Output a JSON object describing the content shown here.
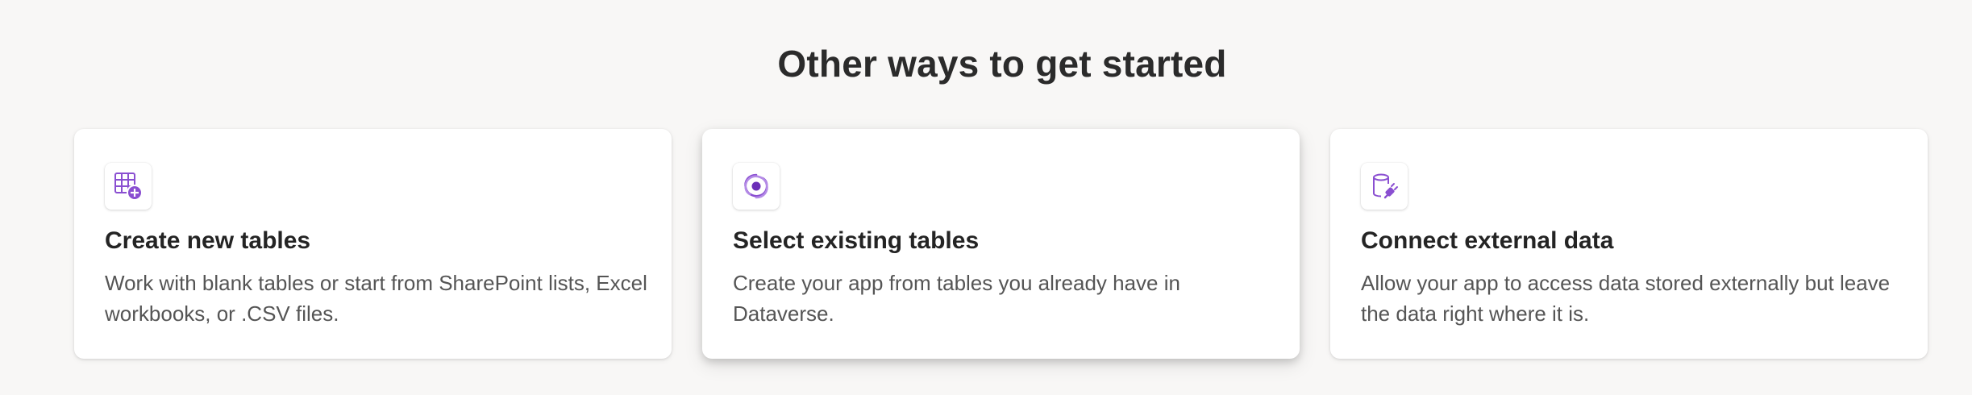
{
  "page": {
    "heading": "Other ways to get started"
  },
  "cards": [
    {
      "title": "Create new tables",
      "description": "Work with blank tables or start from SharePoint lists, Excel workbooks, or .CSV files.",
      "icon": "table-add-icon"
    },
    {
      "title": "Select existing tables",
      "description": "Create your app from tables you already have in Dataverse.",
      "icon": "dataverse-icon"
    },
    {
      "title": "Connect external data",
      "description": "Allow your app to access data stored externally but leave the data right where it is.",
      "icon": "database-plug-icon"
    }
  ],
  "colors": {
    "background": "#f8f7f6",
    "accent": "#8a4fd1",
    "card": "#ffffff"
  }
}
